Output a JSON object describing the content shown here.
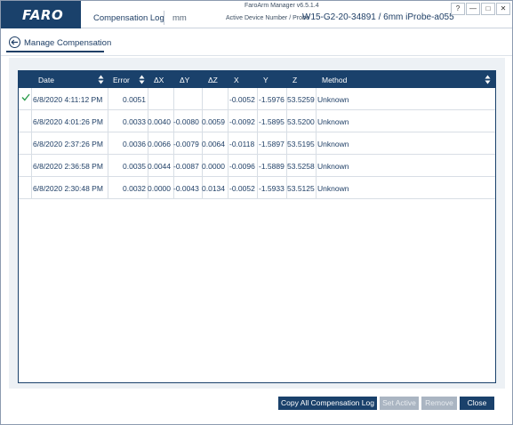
{
  "app": {
    "logo": "FARO",
    "module": "Compensation Log",
    "units": "mm",
    "version": "FaroArm Manager v6.5.1.4",
    "device_label": "Active Device Number / Probe",
    "device_value": "W15-G2-20-34891 / 6mm iProbe-a055",
    "window_buttons": [
      "?",
      "—",
      "□",
      "✕"
    ]
  },
  "subheader": {
    "title": "Manage Compensation",
    "back_icon": "back-arrow-circle-icon"
  },
  "table": {
    "columns": [
      "Date",
      "Error",
      "ΔX",
      "ΔY",
      "ΔZ",
      "X",
      "Y",
      "Z",
      "Method"
    ],
    "rows": [
      {
        "active": true,
        "cells": [
          "6/8/2020 4:11:12 PM",
          "0.0051",
          "",
          "",
          "",
          "-0.0052",
          "-1.5976",
          "53.5259",
          "Unknown"
        ]
      },
      {
        "active": false,
        "cells": [
          "6/8/2020 4:01:26 PM",
          "0.0033",
          "0.0040",
          "-0.0080",
          "0.0059",
          "-0.0092",
          "-1.5895",
          "53.5200",
          "Unknown"
        ]
      },
      {
        "active": false,
        "cells": [
          "6/8/2020 2:37:26 PM",
          "0.0036",
          "0.0066",
          "-0.0079",
          "0.0064",
          "-0.0118",
          "-1.5897",
          "53.5195",
          "Unknown"
        ]
      },
      {
        "active": false,
        "cells": [
          "6/8/2020 2:36:58 PM",
          "0.0035",
          "0.0044",
          "-0.0087",
          "0.0000",
          "-0.0096",
          "-1.5889",
          "53.5258",
          "Unknown"
        ]
      },
      {
        "active": false,
        "cells": [
          "6/8/2020 2:30:48 PM",
          "0.0032",
          "0.0000",
          "-0.0043",
          "0.0134",
          "-0.0052",
          "-1.5933",
          "53.5125",
          "Unknown"
        ]
      }
    ]
  },
  "footer": {
    "copy_all": "Copy All Compensation Log",
    "set_active": "Set Active",
    "remove": "Remove",
    "close": "Close"
  },
  "colors": {
    "brand_navy": "#1a416b",
    "text_blue": "#1f3f66",
    "disabled": "#aab5c2",
    "check_green": "#2e9e4e"
  }
}
